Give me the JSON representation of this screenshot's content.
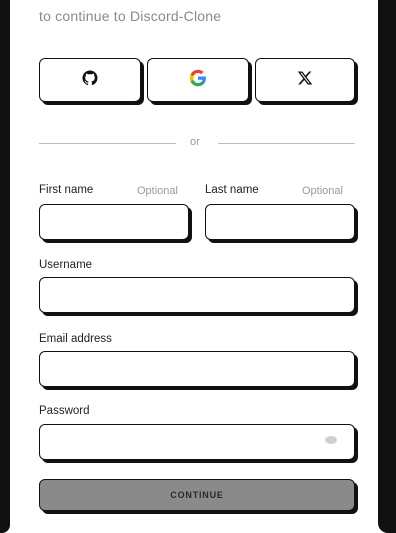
{
  "header": {
    "subtitle": "to continue to Discord-Clone"
  },
  "social": {
    "github_icon": "github-icon",
    "google_icon": "google-icon",
    "x_icon": "x-icon",
    "google_colors": [
      "#4285F4",
      "#EA4335",
      "#FBBC05",
      "#34A853"
    ]
  },
  "divider": {
    "text": "or"
  },
  "form": {
    "first_name_label": "First name",
    "first_name_optional": "Optional",
    "last_name_label": "Last name",
    "last_name_optional": "Optional",
    "username_label": "Username",
    "email_label": "Email address",
    "password_label": "Password",
    "first_name_value": "",
    "last_name_value": "",
    "username_value": "",
    "email_value": "",
    "password_value": ""
  },
  "actions": {
    "continue_label": "CONTINUE"
  },
  "colors": {
    "border": "#111111",
    "button_disabled_bg": "#8a8a8a",
    "muted_text": "#9a9a9a"
  }
}
